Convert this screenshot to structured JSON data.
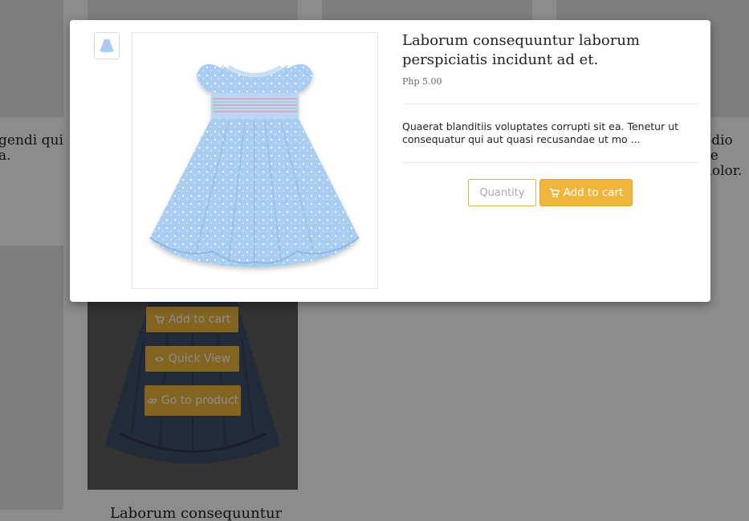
{
  "background": {
    "left_text_lines": [
      "gendi qui",
      "a."
    ],
    "right_text_lines": [
      "odio se",
      "dolor."
    ],
    "hover_buttons": {
      "add_to_cart": "Add to cart",
      "quick_view": "Quick View",
      "go_to_product": "Go to product"
    },
    "bottom_product_title": "Laborum consequuntur"
  },
  "modal": {
    "title": "Laborum consequuntur laborum perspiciatis incidunt ad et.",
    "price": "Php 5.00",
    "description": "Quaerat blanditiis voluptates corrupti sit ea. Tenetur ut consequatur qui aut quasi recusandae ut mo ...",
    "quantity_placeholder": "Quantity",
    "add_to_cart_label": "Add to cart"
  },
  "colors": {
    "accent": "#f0b63c",
    "dress_blue": "#a9cdf0",
    "overlay": "rgba(0,0,0,0.45)"
  },
  "icons": {
    "cart": "cart-icon",
    "eye": "eye-icon",
    "link": "link-icon"
  }
}
